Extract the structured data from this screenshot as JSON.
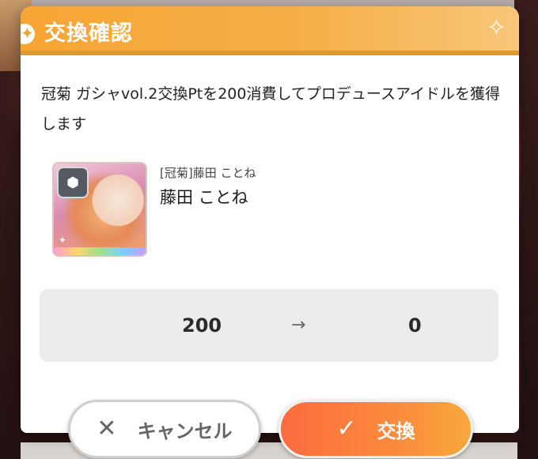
{
  "dialog": {
    "title": "交換確認",
    "message": "冠菊 ガシャvol.2交換Ptを200消費してプロデュースアイドルを獲得します"
  },
  "card": {
    "subtitle": "[冠菊]藤田 ことね",
    "name": "藤田 ことね"
  },
  "points": {
    "from": "200",
    "arrow": "→",
    "to": "0"
  },
  "buttons": {
    "cancel_label": "キャンセル",
    "confirm_label": "交換"
  },
  "icons": {
    "cancel": "close-icon",
    "confirm": "check-icon",
    "header_star": "star-icon",
    "header_sparkle": "sparkle-icon"
  },
  "colors": {
    "header_orange": "#f7a534",
    "confirm_orange": "#fb6c3e",
    "panel_gray": "#ececec"
  }
}
